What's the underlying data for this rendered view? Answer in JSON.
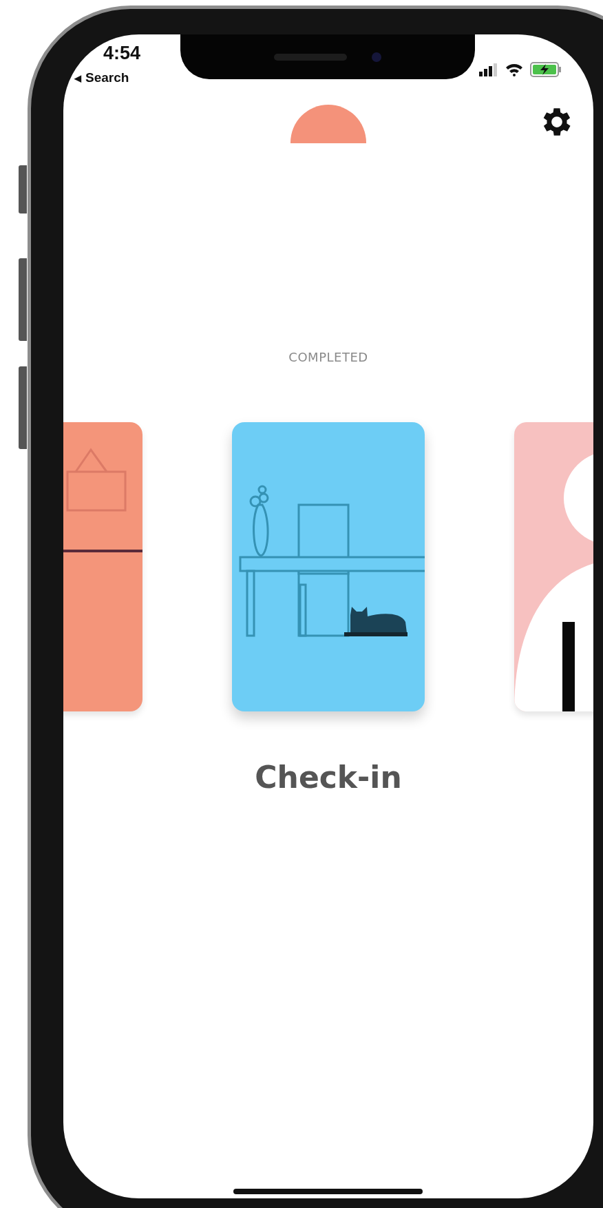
{
  "status_bar": {
    "time": "4:54",
    "back_arrow": "◀",
    "back_label": "Search"
  },
  "section_label": "COMPLETED",
  "cards": [
    {
      "kind": "frame",
      "color": "#f4957a",
      "selected": false
    },
    {
      "kind": "table",
      "color": "#6dcdf5",
      "selected": true
    },
    {
      "kind": "figure",
      "color": "#f7c1c0",
      "selected": false
    }
  ],
  "title": "Check-in"
}
